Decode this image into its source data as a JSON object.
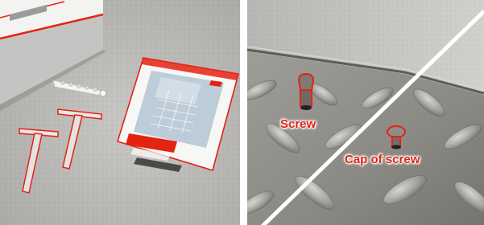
{
  "callouts": {
    "screw": "Screw",
    "cap_of_screw": "Cap of screw"
  },
  "colors": {
    "accent_red": "#e42313",
    "concrete": "#b9b8b5",
    "steel": "#8d8d88",
    "white": "#ffffff"
  },
  "icons": {
    "left": [
      "installation-tool",
      "t-handle-key",
      "manual-document",
      "rivet-strip",
      "trench-drain-frame"
    ],
    "right": [
      "checker-plate-cover",
      "screw-highlight",
      "cap-highlight"
    ]
  }
}
